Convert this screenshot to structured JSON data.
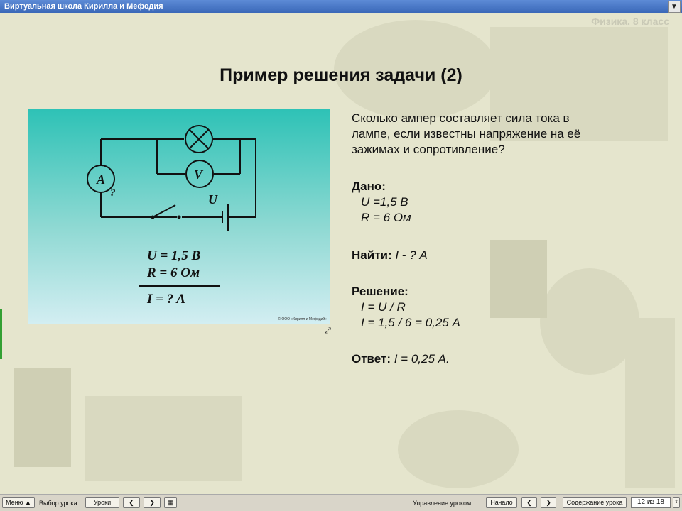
{
  "window": {
    "title": "Виртуальная школа Кирилла и Мефодия",
    "dropdown": "▼"
  },
  "subject": "Физика. 8 класс",
  "heading": "Пример решения задачи (2)",
  "slide": {
    "ammeter": "A",
    "voltmeter": "V",
    "question": "?",
    "voltage_symbol": "U",
    "formula_u": "U = 1,5 В",
    "formula_r": "R = 6 Ом",
    "formula_i": "I =  ?  A",
    "copyright": "© ООО «Кирилл и Мефодий»"
  },
  "problem": {
    "question_line1": "Сколько ампер составляет сила тока в",
    "question_line2": "лампе, если известны напряжение на её",
    "question_line3": "зажимах и сопротивление?",
    "given_label": "Дано:",
    "given_u": "U =1,5 В",
    "given_r": "R = 6 Ом",
    "find_label": "Найти:",
    "find_value": "I - ? А",
    "solution_label": "Решение:",
    "solution_1": "I = U / R",
    "solution_2": "I = 1,5 / 6 = 0,25 А",
    "answer_label": "Ответ:",
    "answer_value": "I = 0,25 А."
  },
  "toolbar": {
    "menu": "Меню ▲",
    "choose_lesson": "Выбор урока:",
    "lessons": "Уроки",
    "prev": "❮",
    "next": "❯",
    "lesson_control": "Управление уроком:",
    "start": "Начало",
    "contents": "Содержание урока",
    "page": "12 из 18"
  }
}
